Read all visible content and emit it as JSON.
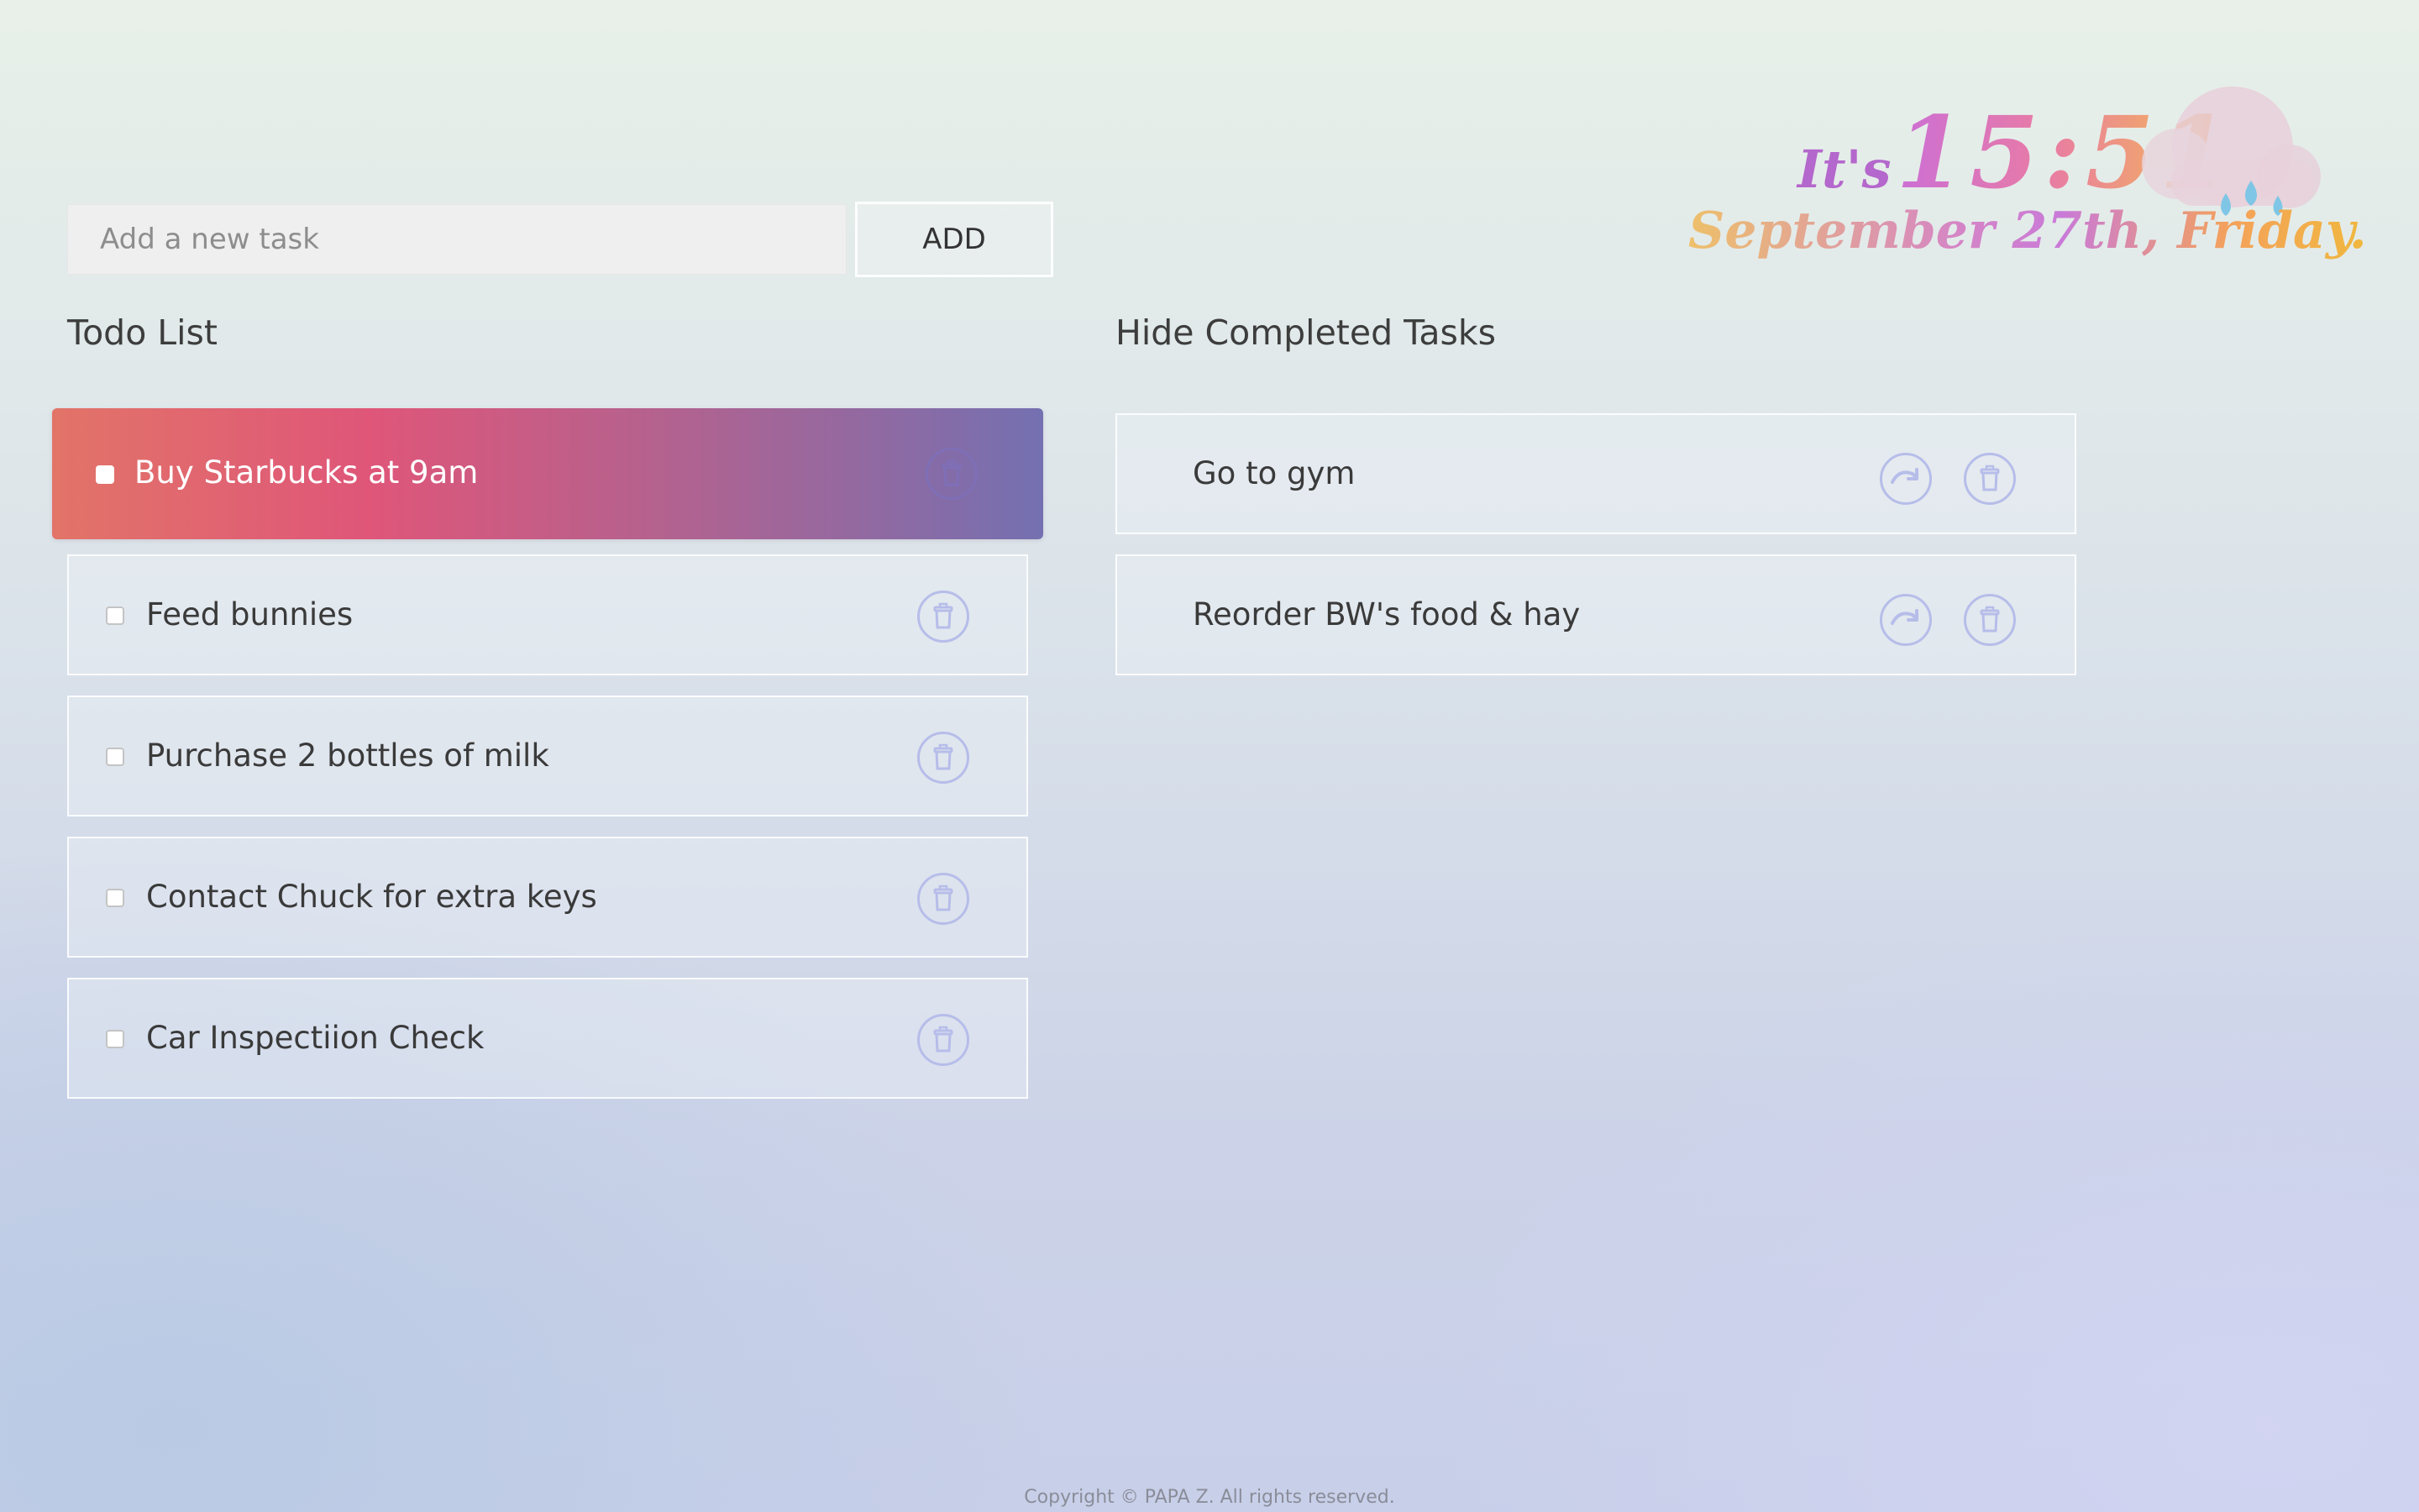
{
  "add_task": {
    "placeholder": "Add a new task",
    "value": "",
    "button_label": "ADD"
  },
  "clock": {
    "prefix": "It's",
    "time": "15:51",
    "date": "September 27th, Friday.",
    "weather_icon": "cloud-rain-icon"
  },
  "todo": {
    "heading": "Todo List",
    "tasks": [
      {
        "text": "Buy Starbucks at 9am",
        "checked": false,
        "highlighted": true
      },
      {
        "text": "Feed bunnies",
        "checked": false
      },
      {
        "text": "Purchase 2 bottles of milk",
        "checked": false
      },
      {
        "text": "Contact Chuck for extra keys",
        "checked": false
      },
      {
        "text": "Car Inspectiion Check",
        "checked": false
      }
    ]
  },
  "completed": {
    "toggle_label": "Hide Completed Tasks",
    "tasks": [
      {
        "text": "Go to gym"
      },
      {
        "text": "Reorder BW's food & hay"
      }
    ]
  },
  "footer": {
    "text": "Copyright © PAPA Z. All rights reserved."
  },
  "colors": {
    "active_gradient": [
      "#e27468",
      "#df5679",
      "#b3628f",
      "#7470b1"
    ],
    "icon_outline": "#b6bde9"
  }
}
